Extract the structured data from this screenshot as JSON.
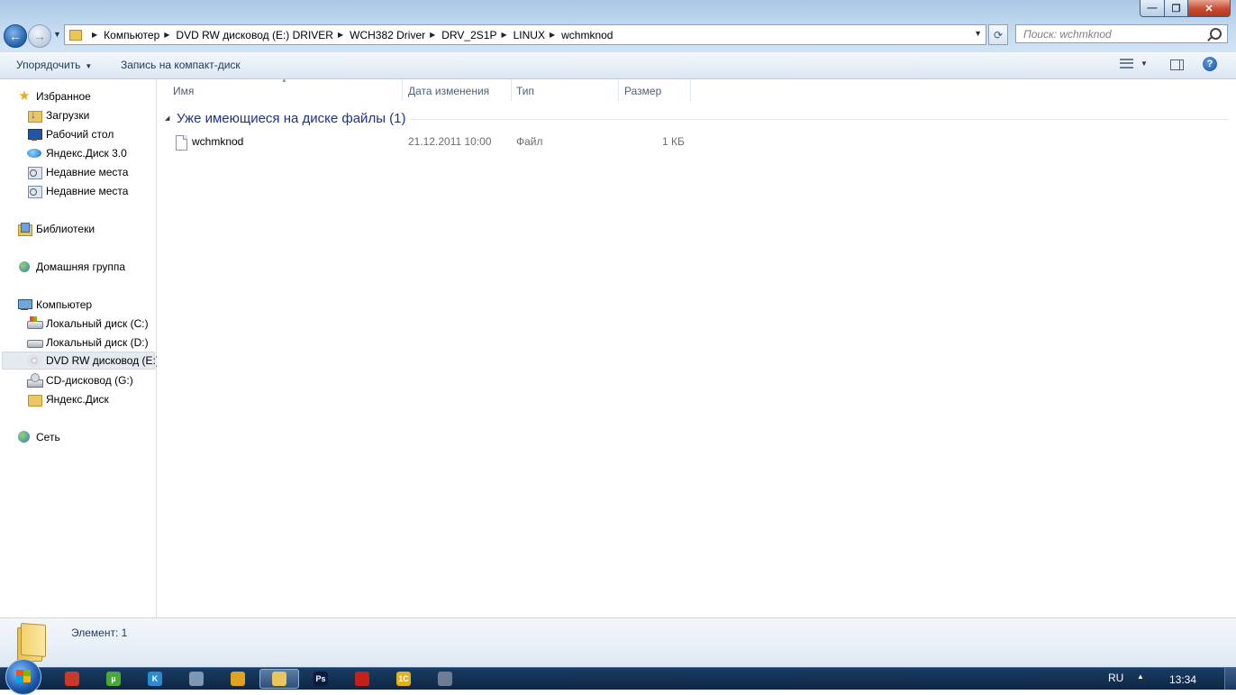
{
  "window": {
    "minimize_symbol": "—",
    "maximize_symbol": "❐",
    "close_symbol": "✕"
  },
  "nav": {
    "back_symbol": "←",
    "forward_symbol": "→",
    "history_symbol": "▼"
  },
  "address": {
    "crumbs": [
      "Компьютер",
      "DVD RW дисковод (E:) DRIVER",
      "WCH382 Driver",
      "DRV_2S1P",
      "LINUX",
      "wchmknod"
    ],
    "refresh_symbol": "⟳"
  },
  "search": {
    "placeholder": "Поиск: wchmknod"
  },
  "toolbar": {
    "organize_label": "Упорядочить",
    "burn_label": "Запись на компакт-диск",
    "help_symbol": "?"
  },
  "sidebar": {
    "favorites": {
      "header": "Избранное",
      "items": [
        "Загрузки",
        "Рабочий стол",
        "Яндекс.Диск 3.0",
        "Недавние места",
        "Недавние места"
      ]
    },
    "libraries": "Библиотеки",
    "homegroup": "Домашняя группа",
    "computer": {
      "header": "Компьютер",
      "items": [
        "Локальный диск (C:)",
        "Локальный диск (D:)",
        "DVD RW дисковод (E:)",
        "CD-дисковод (G:)",
        "Яндекс.Диск"
      ],
      "selected_index": 2
    },
    "network": "Сеть"
  },
  "columns": {
    "name": "Имя",
    "date": "Дата изменения",
    "type": "Тип",
    "size": "Размер"
  },
  "group": {
    "title": "Уже имеющиеся на диске файлы (1)"
  },
  "files": [
    {
      "name": "wchmknod",
      "date": "21.12.2011 10:00",
      "type": "Файл",
      "size": "1 КБ"
    }
  ],
  "details": {
    "count_text": "Элемент: 1"
  },
  "taskbar": {
    "apps": [
      {
        "name": "app-1",
        "label": "",
        "color": "#c93a2a"
      },
      {
        "name": "utorrent",
        "label": "µ",
        "color": "#4aa838"
      },
      {
        "name": "kaspersky",
        "label": "K",
        "color": "#2b8bd0"
      },
      {
        "name": "calculator",
        "label": "",
        "color": "#7f96b4"
      },
      {
        "name": "chrome",
        "label": "",
        "color": "#e0a321"
      },
      {
        "name": "explorer",
        "label": "",
        "color": "#e9c65d"
      },
      {
        "name": "photoshop",
        "label": "Ps",
        "color": "#0b1b3b"
      },
      {
        "name": "acrobat",
        "label": "",
        "color": "#c4211a"
      },
      {
        "name": "1c",
        "label": "1С",
        "color": "#e1b21c"
      },
      {
        "name": "app-10",
        "label": "",
        "color": "#6d7e93"
      }
    ],
    "active_index": 5,
    "lang": "RU",
    "tray_up": "▲",
    "clock": "13:34"
  }
}
